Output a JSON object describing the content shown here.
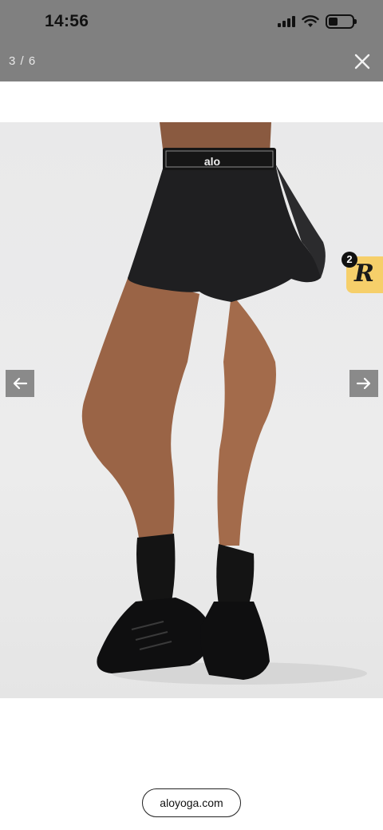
{
  "status_bar": {
    "time": "14:56",
    "icons": [
      "signal-icon",
      "wifi-icon",
      "battery-icon"
    ],
    "battery_level": 0.4
  },
  "viewer": {
    "counter": "3 / 6",
    "close_icon": "close-icon",
    "prev_icon": "arrow-left-icon",
    "next_icon": "arrow-right-icon"
  },
  "product_image": {
    "waistband_logo": "alo"
  },
  "badge": {
    "count": "2",
    "letter": "R"
  },
  "footer": {
    "url": "aloyoga.com"
  },
  "colors": {
    "overlay": "#808080",
    "badge": "#f6cf6a",
    "arrow_button": "#8a8a8a"
  }
}
